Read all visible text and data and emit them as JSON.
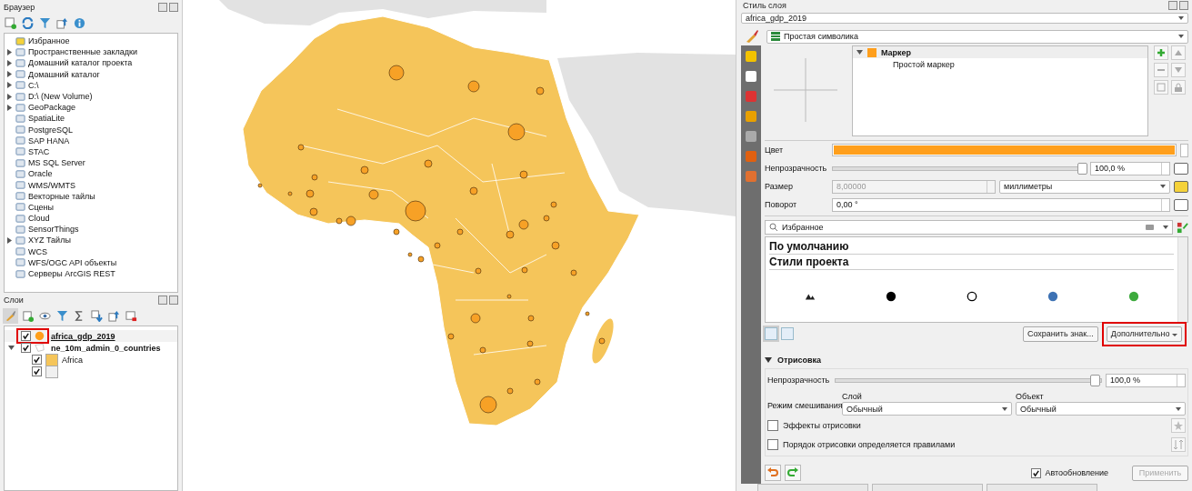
{
  "browser": {
    "title": "Браузер",
    "items": [
      {
        "label": "Избранное",
        "has_children": false
      },
      {
        "label": "Пространственные закладки",
        "has_children": true
      },
      {
        "label": "Домашний каталог проекта",
        "has_children": true
      },
      {
        "label": "Домашний каталог",
        "has_children": true
      },
      {
        "label": "C:\\",
        "has_children": true
      },
      {
        "label": "D:\\ (New Volume)",
        "has_children": true
      },
      {
        "label": "GeoPackage",
        "has_children": true
      },
      {
        "label": "SpatiaLite",
        "has_children": false
      },
      {
        "label": "PostgreSQL",
        "has_children": false
      },
      {
        "label": "SAP HANA",
        "has_children": false
      },
      {
        "label": "STAC",
        "has_children": false
      },
      {
        "label": "MS SQL Server",
        "has_children": false
      },
      {
        "label": "Oracle",
        "has_children": false
      },
      {
        "label": "WMS/WMTS",
        "has_children": false
      },
      {
        "label": "Векторные тайлы",
        "has_children": false
      },
      {
        "label": "Сцены",
        "has_children": false
      },
      {
        "label": "Cloud",
        "has_children": false
      },
      {
        "label": "SensorThings",
        "has_children": false
      },
      {
        "label": "XYZ Тайлы",
        "has_children": true
      },
      {
        "label": "WCS",
        "has_children": false
      },
      {
        "label": "WFS/OGC API объекты",
        "has_children": false
      },
      {
        "label": "Серверы ArcGIS REST",
        "has_children": false
      }
    ]
  },
  "layers": {
    "title": "Слои",
    "items": [
      {
        "label": "africa_gdp_2019",
        "kind": "point",
        "checked": true,
        "selected": true,
        "highlighted": true,
        "color": "#ff9f1c"
      },
      {
        "label": "ne_10m_admin_0_countries",
        "kind": "polygon",
        "checked": true,
        "selected": false,
        "highlighted": false,
        "expanded": true,
        "children": [
          {
            "label": "Africa",
            "checked": true,
            "color": "#f5c55a"
          },
          {
            "checked": true,
            "color": "#f0f0f0"
          }
        ]
      }
    ]
  },
  "style_panel": {
    "title": "Стиль слоя",
    "layer": "africa_gdp_2019",
    "renderer": "Простая символика",
    "symbol_tree": {
      "label": "Маркер",
      "expanded": true,
      "color": "#ff9f1c",
      "children": [
        "Простой маркер"
      ]
    },
    "color": {
      "label": "Цвет",
      "color": "#ff9f1c"
    },
    "opacity": {
      "label": "Непрозрачность",
      "level": 0.99,
      "value": "100,0 %"
    },
    "size": {
      "label": "Размер",
      "value": "8,00000",
      "disabled": true,
      "unit": "миллиметры"
    },
    "rotation": {
      "label": "Поворот",
      "value": "0,00 °"
    },
    "search": {
      "value": "Избранное"
    },
    "library_groups": [
      "По умолчанию",
      "Стили проекта"
    ],
    "library_symbols": [
      {
        "kind": "triangles"
      },
      {
        "kind": "dot",
        "color": "#000000"
      },
      {
        "kind": "ring"
      },
      {
        "kind": "dot",
        "color": "#3d72b4"
      },
      {
        "kind": "dot",
        "color": "#3daa3d"
      }
    ],
    "save_button": "Сохранить знак...",
    "more_button": {
      "label": "Дополнительно",
      "highlighted": true
    },
    "rendering": {
      "title": "Отрисовка",
      "expanded": true,
      "opacity": {
        "label": "Непрозрачность",
        "level": 0.98,
        "value": "100,0 %"
      },
      "blend_label": "Режим смешивания",
      "layer_label": "Слой",
      "layer_value": "Обычный",
      "object_label": "Объект",
      "object_value": "Обычный",
      "checks": [
        {
          "label": "Эффекты отрисовки",
          "checked": false
        },
        {
          "label": "Порядок отрисовки определяется правилами",
          "checked": false
        }
      ]
    },
    "auto_update": {
      "label": "Автообновление",
      "checked": true
    },
    "apply": {
      "label": "Применить",
      "disabled": true
    }
  }
}
